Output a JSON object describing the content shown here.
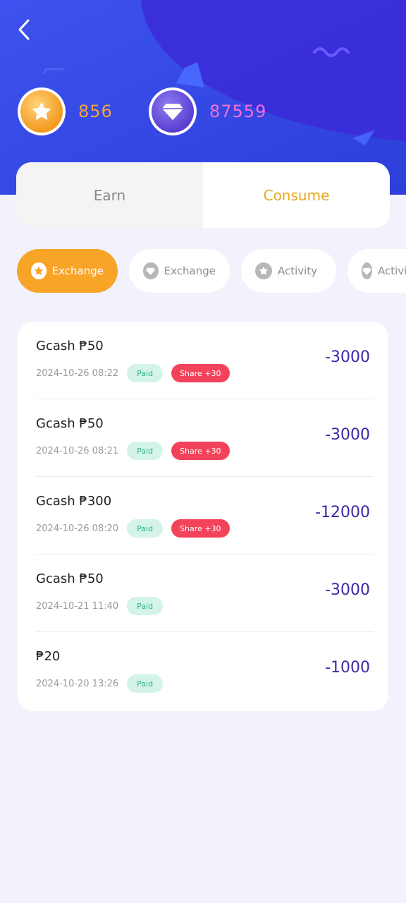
{
  "header": {
    "back_icon": "chevron-left-icon",
    "star_balance": "856",
    "gem_balance": "87559",
    "star_color": "#f6a338",
    "gem_color": "#f46fd6"
  },
  "tabs": [
    {
      "label": "Earn",
      "active": false
    },
    {
      "label": "Consume",
      "active": true
    }
  ],
  "filters": [
    {
      "label": "Exchange",
      "icon": "star-icon",
      "active": true
    },
    {
      "label": "Exchange",
      "icon": "diamond-icon",
      "active": false
    },
    {
      "label": "Activity",
      "icon": "star-icon",
      "active": false
    },
    {
      "label": "Activity",
      "icon": "diamond-icon",
      "active": false
    }
  ],
  "records": [
    {
      "title": "Gcash ₱50",
      "date": "2024-10-26 08:22",
      "status": "Paid",
      "share": "Share +30",
      "value": "-3000"
    },
    {
      "title": "Gcash ₱50",
      "date": "2024-10-26 08:21",
      "status": "Paid",
      "share": "Share +30",
      "value": "-3000"
    },
    {
      "title": "Gcash ₱300",
      "date": "2024-10-26 08:20",
      "status": "Paid",
      "share": "Share +30",
      "value": "-12000"
    },
    {
      "title": "Gcash ₱50",
      "date": "2024-10-21 11:40",
      "status": "Paid",
      "share": "",
      "value": "-3000"
    },
    {
      "title": "₱20",
      "date": "2024-10-20 13:26",
      "status": "Paid",
      "share": "",
      "value": "-1000"
    }
  ]
}
